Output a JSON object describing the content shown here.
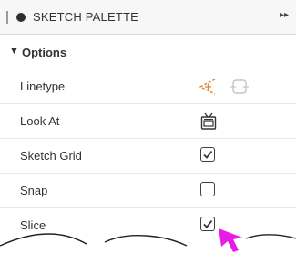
{
  "palette": {
    "title": "SKETCH PALETTE",
    "expand_icon": "double-chevron-right-icon"
  },
  "section": {
    "label": "Options",
    "caret_icon": "caret-down-icon"
  },
  "rows": [
    {
      "label": "Linetype",
      "icons": [
        "linetype-construction-icon",
        "linetype-centerline-icon"
      ]
    },
    {
      "label": "Look At",
      "icons": [
        "look-at-icon"
      ]
    },
    {
      "label": "Sketch Grid",
      "checked": true
    },
    {
      "label": "Snap",
      "checked": false
    },
    {
      "label": "Slice",
      "checked": true
    }
  ],
  "colors": {
    "accent_arrow": "#e81ce8"
  }
}
